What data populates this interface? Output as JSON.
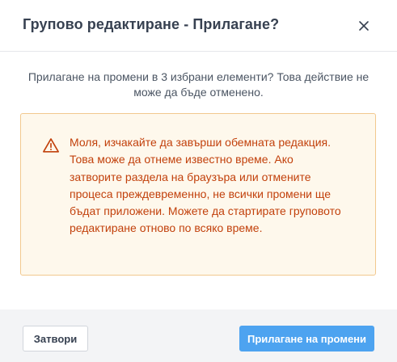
{
  "dialog": {
    "title": "Групово редактиране - Прилагане?",
    "close_icon": "close-icon",
    "confirmation_text": "Прилагане на промени в 3 избрани елементи? Това действие не може да бъде отменено.",
    "warning": {
      "icon": "warning-triangle-icon",
      "text": "Моля, изчакайте да завърши обемната редакция. Това може да отнеме известно време. Ако затворите раздела на браузъра или отмените процеса преждевременно, не всички промени ще бъдат приложени. Можете да стартирате груповото редактиране отново по всяко време."
    },
    "footer": {
      "close_label": "Затвори",
      "apply_label": "Прилагане на промени"
    }
  },
  "colors": {
    "title": "#374151",
    "warning_text": "#c2410c",
    "warning_bg": "#fef8ec",
    "warning_border": "#f2c88e",
    "primary_button": "#4da3f0",
    "footer_bg": "#f3f4f6"
  }
}
